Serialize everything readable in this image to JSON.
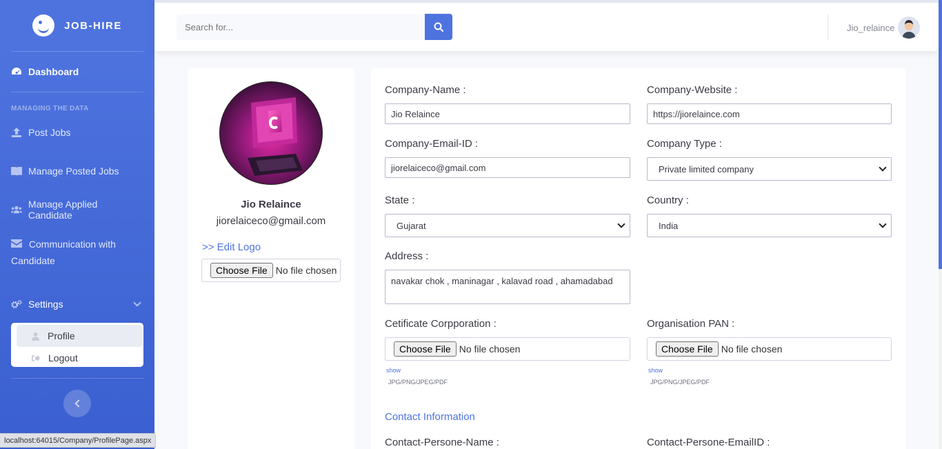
{
  "brand": {
    "name": "JOB-HIRE",
    "icon": "laugh-wink-icon"
  },
  "sidebar": {
    "dashboard": "Dashboard",
    "heading": "MANAGING THE DATA",
    "items": [
      {
        "label": "Post Jobs",
        "icon": "upload-icon"
      },
      {
        "label": "Manage Posted Jobs",
        "icon": "book-icon"
      },
      {
        "label": "Manage Applied Candidate",
        "icon": "users-icon"
      },
      {
        "label": "Communication with Candidate",
        "icon": "envelope-icon"
      }
    ],
    "settings": "Settings",
    "submenu": [
      {
        "label": "Profile",
        "icon": "user-icon"
      },
      {
        "label": "Logout",
        "icon": "sign-out-icon"
      }
    ]
  },
  "topbar": {
    "search_placeholder": "Search for...",
    "username": "Jio_relaince"
  },
  "profile": {
    "name": "Jio Relaince",
    "email": "jiorelaiceco@gmail.com",
    "edit_logo": ">> Edit Logo",
    "file_button": "Choose File",
    "file_status": "No file chosen"
  },
  "form": {
    "company_name_label": "Company-Name :",
    "company_name": "Jio Relaince",
    "company_website_label": "Company-Website :",
    "company_website": "https://jiorelaince.com",
    "company_email_label": "Company-Email-ID :",
    "company_email": "jiorelaiceco@gmail.com",
    "company_type_label": "Company Type :",
    "company_type": "Private limited company",
    "state_label": "State :",
    "state": "Gujarat",
    "country_label": "Country :",
    "country": "India",
    "address_label": "Address :",
    "address": "navakar chok , maninagar , kalavad road , ahamadabad",
    "cert_label": "Cetificate Corpporation :",
    "pan_label": "Organisation PAN :",
    "file_button": "Choose File",
    "file_status": "No file chosen",
    "show_link": "show",
    "file_types": "JPG/PNG/JPEG/PDF",
    "contact_title": "Contact Information",
    "contact_name_label": "Contact-Persone-Name :",
    "contact_email_label": "Contact-Persone-EmailID :"
  },
  "status_url": "localhost:64015/Company/ProfilePage.aspx",
  "colors": {
    "primary": "#4e73df",
    "background": "#f8f9fc"
  }
}
